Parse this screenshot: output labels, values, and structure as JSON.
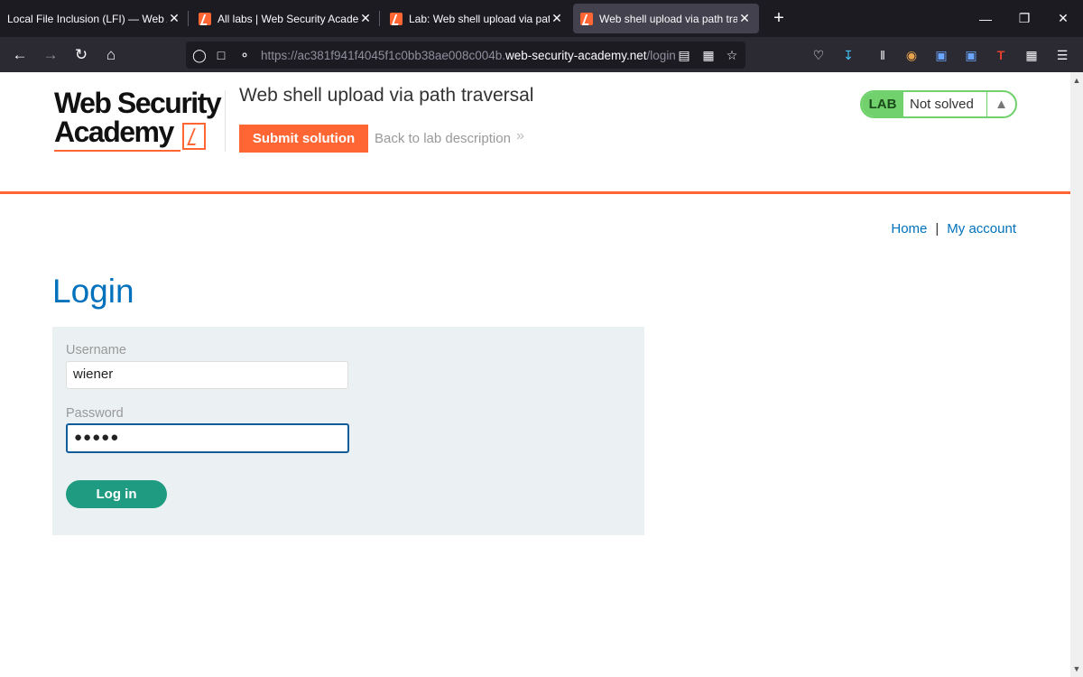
{
  "browser": {
    "tabs": [
      {
        "title": "Local File Inclusion (LFI) — Web App",
        "close": "✕"
      },
      {
        "title": "All labs | Web Security Academy",
        "close": "✕"
      },
      {
        "title": "Lab: Web shell upload via path t",
        "close": "✕"
      },
      {
        "title": "Web shell upload via path travers",
        "close": "✕"
      }
    ],
    "new_tab": "+",
    "url_prefix": "https://ac381f941f4045f1c0bb38ae008c004b.",
    "url_host": "web-security-academy.net",
    "url_path": "/login"
  },
  "header": {
    "logo_line1": "Web Security",
    "logo_line2": "Academy",
    "lab_title": "Web shell upload via path traversal",
    "submit_label": "Submit solution",
    "back_label": "Back to lab description",
    "back_chevron": "»",
    "status_badge": "LAB",
    "status_text": "Not solved"
  },
  "nav": {
    "home": "Home",
    "separator": "|",
    "my_account": "My account"
  },
  "login": {
    "heading": "Login",
    "username_label": "Username",
    "username_value": "wiener",
    "password_label": "Password",
    "password_dots": "●●●●●",
    "submit_label": "Log in"
  },
  "colors": {
    "accent": "#ff6633",
    "link": "#0071bc",
    "lab_green": "#70d16d",
    "login_button": "#1e9b80",
    "panel_bg": "#ebf0f2"
  },
  "icons": [
    "back-icon",
    "forward-icon",
    "reload-icon",
    "home-icon",
    "shield-icon",
    "lock-icon",
    "key-icon",
    "translate-icon",
    "grid-icon",
    "star-icon",
    "pocket-icon",
    "download-icon",
    "library-icon",
    "extension-icon",
    "menu-icon",
    "flask-icon"
  ]
}
